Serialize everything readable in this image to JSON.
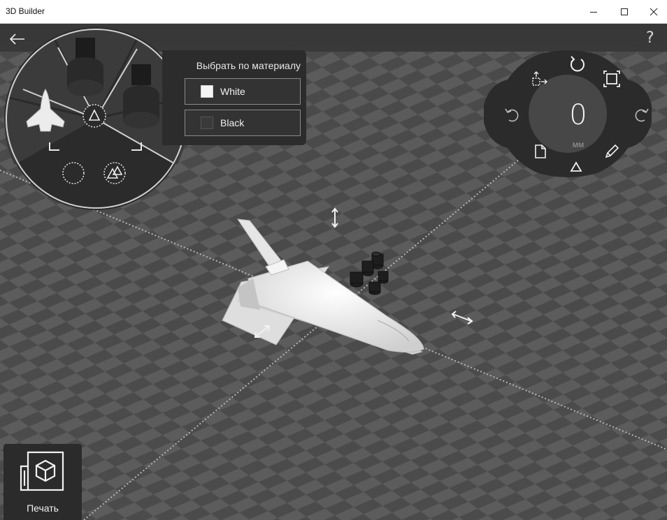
{
  "window": {
    "title": "3D Builder",
    "controls": [
      "minimize",
      "maximize",
      "close"
    ]
  },
  "nav": {
    "back_icon": "arrow-left-icon",
    "help_label": "?"
  },
  "radial_menu": {
    "center_mode_icon": "triangle-select-icon",
    "options": [
      {
        "name": "select-object-shuttle",
        "icon": "shuttle-thumbnail"
      },
      {
        "name": "select-object-engines-1",
        "icon": "engine-thumbnail"
      },
      {
        "name": "select-object-engines-2",
        "icon": "engine-thumbnail"
      },
      {
        "name": "select-none",
        "icon": "dashed-circle-icon"
      },
      {
        "name": "select-by-material",
        "icon": "material-select-icon"
      }
    ]
  },
  "material_panel": {
    "heading": "Выбрать по материалу",
    "items": [
      {
        "label": "White",
        "color": "#f4f4f4"
      },
      {
        "label": "Black",
        "color": "#3a3a3a"
      }
    ]
  },
  "transform_control": {
    "value": "0",
    "unit": "мм",
    "icons": [
      "rotate-icon",
      "move-to-floor-icon",
      "scale-frame-icon",
      "undo-icon",
      "redo-icon",
      "new-document-icon",
      "pencil-icon",
      "triangle-mode-icon"
    ]
  },
  "print_button": {
    "label": "Печать",
    "icon": "print-3d-icon"
  },
  "scene": {
    "gizmo_icons": [
      "vertical-arrow-icon",
      "horizontal-arrow-icon",
      "diagonal-arrow-icon"
    ],
    "colors": {
      "floor_dark": "#424242",
      "floor_light": "#5e5e5e",
      "panel": "#2b2b2b",
      "accent_line": "#c9c9c9"
    }
  }
}
